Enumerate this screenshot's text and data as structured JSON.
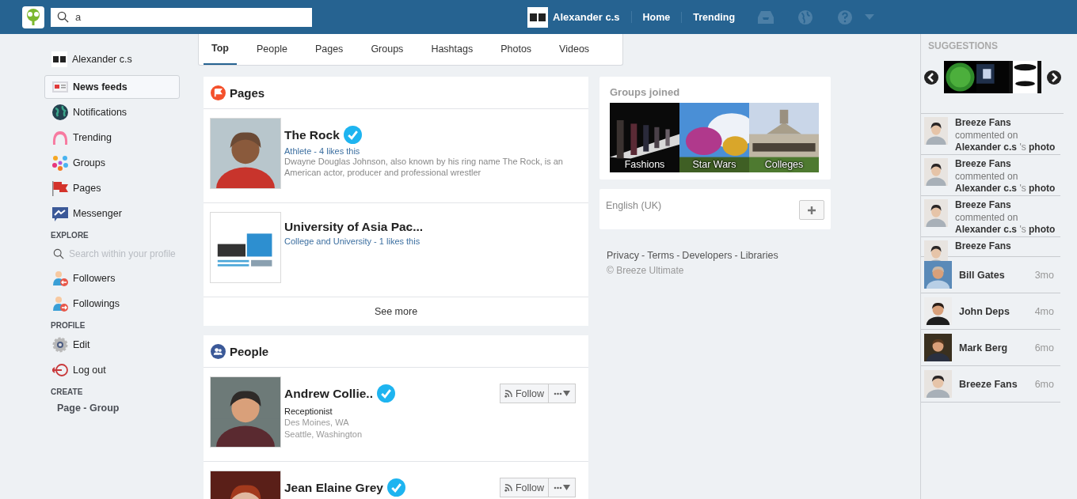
{
  "topbar": {
    "search": {
      "value": "a"
    },
    "user": "Alexander c.s",
    "links": [
      "Home",
      "Trending"
    ]
  },
  "sidebar": {
    "user": "Alexander c.s",
    "menu": [
      {
        "kind": "news",
        "label": "News feeds",
        "selected": true
      },
      {
        "kind": "globe",
        "label": "Notifications",
        "selected": false
      },
      {
        "kind": "trending",
        "label": "Trending",
        "selected": false
      },
      {
        "kind": "groups",
        "label": "Groups",
        "selected": false
      },
      {
        "kind": "pages",
        "label": "Pages",
        "selected": false
      },
      {
        "kind": "messenger",
        "label": "Messenger",
        "selected": false
      }
    ],
    "explore": {
      "heading": "EXPLORE",
      "search_placeholder": "Search within your profile",
      "items": [
        {
          "kind": "followers",
          "label": "Followers"
        },
        {
          "kind": "followings",
          "label": "Followings"
        }
      ]
    },
    "profile": {
      "heading": "PROFILE",
      "items": [
        {
          "kind": "edit",
          "label": "Edit"
        },
        {
          "kind": "logout",
          "label": "Log out"
        }
      ]
    },
    "create": {
      "heading": "CREATE",
      "link": "Page - Group"
    }
  },
  "tabs": [
    {
      "label": "Top",
      "selected": true
    },
    {
      "label": "People",
      "selected": false
    },
    {
      "label": "Pages",
      "selected": false
    },
    {
      "label": "Groups",
      "selected": false
    },
    {
      "label": "Hashtags",
      "selected": false
    },
    {
      "label": "Photos",
      "selected": false
    },
    {
      "label": "Videos",
      "selected": false
    }
  ],
  "pages": {
    "title": "Pages",
    "items": [
      {
        "name": "The Rock",
        "verified": true,
        "meta": "Athlete - 4 likes this",
        "description": "Dwayne Douglas Johnson, also known by his ring name The Rock, is an American actor, producer and professional wrestler"
      },
      {
        "name": "University of Asia Pac...",
        "verified": false,
        "meta": "College and University - 1 likes this"
      }
    ],
    "see_more": "See more"
  },
  "people": {
    "title": "People",
    "items": [
      {
        "name": "Andrew Collie..",
        "verified": true,
        "job": "Receptionist",
        "places": [
          "Des Moines, WA",
          "Seattle, Washington"
        ],
        "follow": "Follow"
      },
      {
        "name": "Jean Elaine Grey",
        "verified": true,
        "follow": "Follow"
      }
    ]
  },
  "groups": {
    "title": "Groups joined",
    "items": [
      "Fashions",
      "Star Wars",
      "Colleges"
    ]
  },
  "language": {
    "label": "English (UK)"
  },
  "footer": {
    "links": [
      "Privacy",
      "Terms",
      "Developers",
      "Libraries"
    ],
    "separator": "-",
    "copyright": "© Breeze Ultimate"
  },
  "suggestions": {
    "heading": "SUGGESTIONS",
    "activity": [
      {
        "name": "Breeze Fans",
        "action": "commented on",
        "target": "**Alexander c.s** 's **photo**"
      },
      {
        "name": "Breeze Fans",
        "action": "commented on",
        "target": "**Alexander c.s** 's **photo**"
      },
      {
        "name": "Breeze Fans",
        "action": "commented on",
        "target": "**Alexander c.s** 's **photo**"
      },
      {
        "name": "Breeze Fans"
      }
    ],
    "recent": [
      {
        "name": "Bill Gates",
        "time": "3mo"
      },
      {
        "name": "John Deps",
        "time": "4mo"
      },
      {
        "name": "Mark Berg",
        "time": "6mo"
      },
      {
        "name": "Breeze Fans",
        "time": "6mo"
      }
    ]
  }
}
